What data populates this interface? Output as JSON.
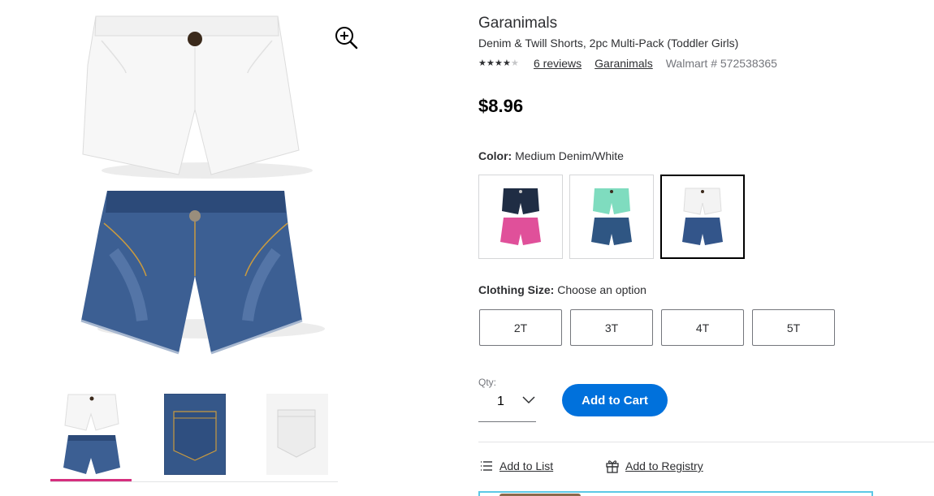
{
  "product": {
    "brand": "Garanimals",
    "name": "Denim & Twill Shorts, 2pc Multi-Pack (Toddler Girls)",
    "rating": 4,
    "rating_max": 5,
    "reviews_label": "6 reviews",
    "brand_link": "Garanimals",
    "item_number": "Walmart # 572538365",
    "price": "$8.96"
  },
  "color": {
    "label": "Color:",
    "selected_value": "Medium Denim/White",
    "swatches": [
      {
        "top_color": "#1f2d44",
        "bottom_color": "#e0509a",
        "selected": false
      },
      {
        "top_color": "#7fdcbf",
        "bottom_color": "#2f5683",
        "selected": false
      },
      {
        "top_color": "#f3f3f3",
        "bottom_color": "#33558a",
        "selected": true
      }
    ]
  },
  "size": {
    "label": "Clothing Size:",
    "value": "Choose an option",
    "options": [
      "2T",
      "3T",
      "4T",
      "5T"
    ]
  },
  "quantity": {
    "label": "Qty:",
    "value": "1"
  },
  "actions": {
    "add_to_cart": "Add to Cart",
    "add_to_list": "Add to List",
    "add_to_registry": "Add to Registry"
  },
  "colors": {
    "accent": "#0071dc",
    "thumb_active": "#d62f7e",
    "denim": "#3c5f93",
    "white_short": "#f6f6f6"
  },
  "icons": {
    "zoom": "zoom-in-icon",
    "qty": "chevron-down-icon",
    "list": "list-icon",
    "registry": "gift-icon"
  }
}
